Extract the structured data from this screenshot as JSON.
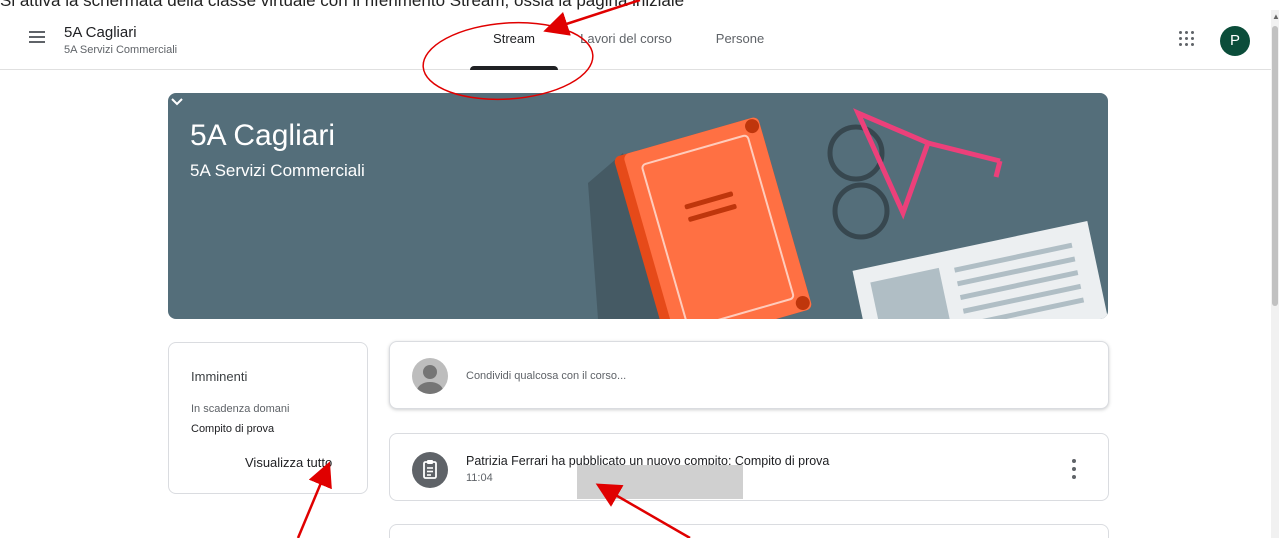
{
  "caption": "Si attiva la schermata della classe virtuale con il riferimento Stream, ossia la pagina iniziale",
  "header": {
    "class_title": "5A Cagliari",
    "class_subtitle": "5A Servizi Commerciali",
    "tabs": [
      {
        "label": "Stream",
        "active": true
      },
      {
        "label": "Lavori del corso",
        "active": false
      },
      {
        "label": "Persone",
        "active": false
      }
    ],
    "avatar_letter": "P",
    "avatar_color": "#0b4d3a"
  },
  "banner": {
    "title": "5A Cagliari",
    "subtitle": "5A Servizi Commerciali",
    "color": "#546e7a"
  },
  "upcoming": {
    "title": "Imminenti",
    "due_label": "In scadenza domani",
    "item": "Compito di prova",
    "view_all": "Visualizza tutto"
  },
  "share": {
    "placeholder": "Condividi qualcosa con il corso..."
  },
  "post": {
    "text": "Patrizia Ferrari ha pubblicato un nuovo compito: Compito di prova",
    "time": "11:04"
  },
  "icons": [
    "menu-icon",
    "apps-icon",
    "chevron-down-icon",
    "assignment-icon",
    "more-vert-icon",
    "user-avatar-icon"
  ]
}
